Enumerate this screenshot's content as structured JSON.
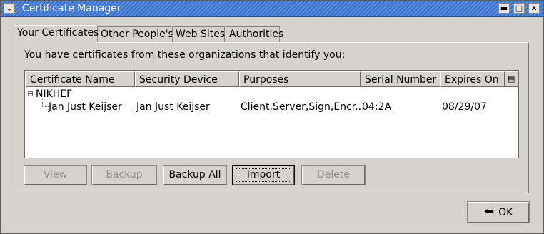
{
  "window": {
    "title": "Certificate Manager"
  },
  "tabs": [
    {
      "label": "Your Certificates",
      "active": true
    },
    {
      "label": "Other People's",
      "active": false
    },
    {
      "label": "Web Sites",
      "active": false
    },
    {
      "label": "Authorities",
      "active": false
    }
  ],
  "intro_text": "You have certificates from these organizations that identify you:",
  "columns": [
    "Certificate Name",
    "Security Device",
    "Purposes",
    "Serial Number",
    "Expires On"
  ],
  "tree": {
    "organization": "NIKHEF",
    "certificate": {
      "name": "Jan Just Keijser",
      "device": "Jan Just Keijser",
      "purposes": "Client,Server,Sign,Encr...",
      "serial": "04:2A",
      "expires": "08/29/07"
    }
  },
  "buttons": {
    "view": "View",
    "backup": "Backup",
    "backup_all": "Backup All",
    "import": "Import",
    "delete": "Delete",
    "ok": "OK"
  },
  "icons": {
    "window_menu": "chevron-down-icon",
    "minimize": "minimize-icon",
    "maximize": "maximize-icon",
    "close": "close-icon",
    "column_picker": "column-picker-icon",
    "ok": "ok-arrow-icon"
  }
}
